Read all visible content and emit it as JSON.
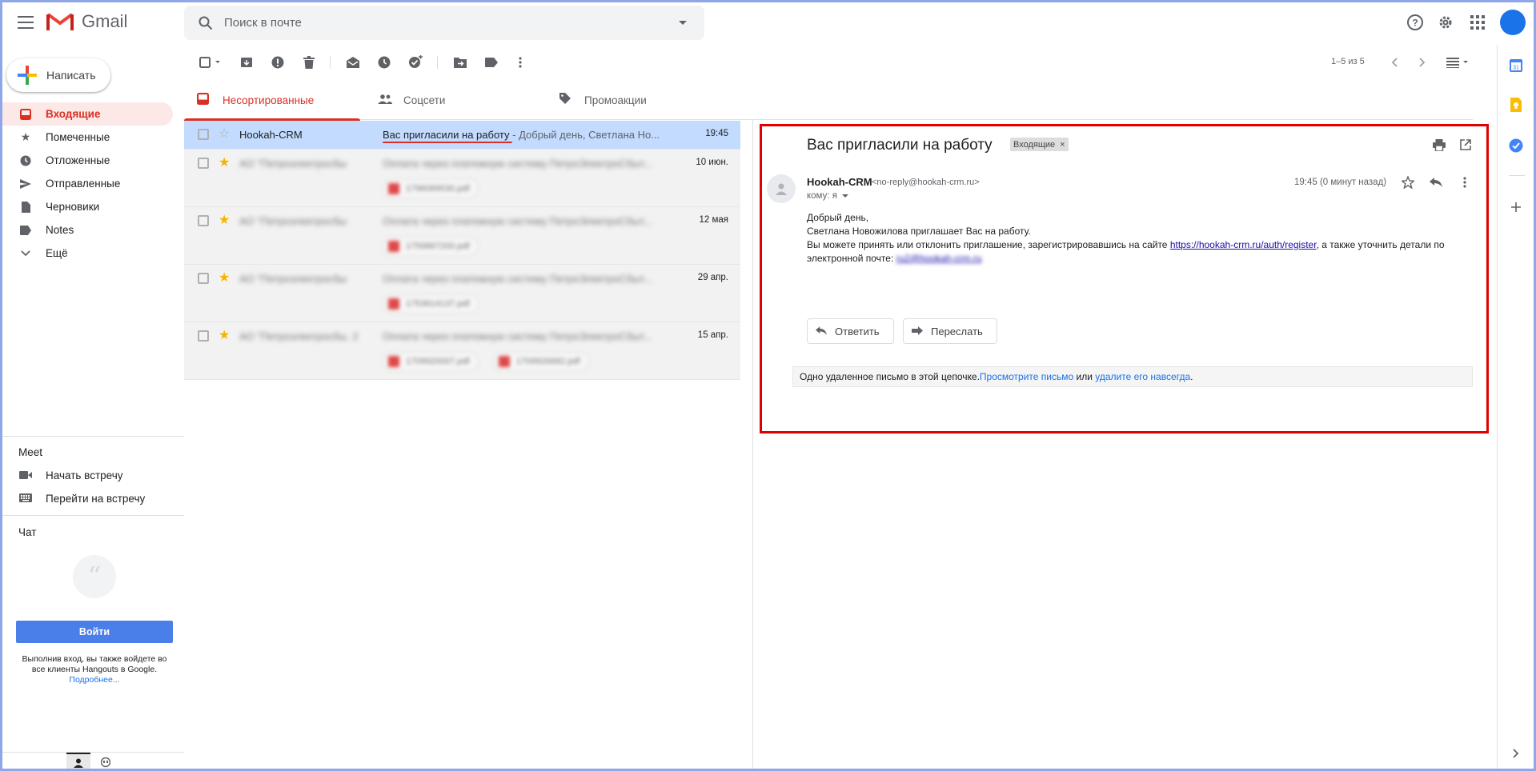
{
  "app": {
    "name": "Gmail"
  },
  "search": {
    "placeholder": "Поиск в почте"
  },
  "compose": {
    "label": "Написать"
  },
  "nav": [
    {
      "label": "Входящие",
      "icon": "inbox-icon",
      "active": true
    },
    {
      "label": "Помеченные",
      "icon": "star-icon"
    },
    {
      "label": "Отложенные",
      "icon": "clock-icon"
    },
    {
      "label": "Отправленные",
      "icon": "send-icon"
    },
    {
      "label": "Черновики",
      "icon": "draft-icon"
    },
    {
      "label": "Notes",
      "icon": "label-icon"
    },
    {
      "label": "Ещё",
      "icon": "chevron-down-icon"
    }
  ],
  "meet": {
    "title": "Meet",
    "items": [
      {
        "label": "Начать встречу",
        "icon": "video-icon"
      },
      {
        "label": "Перейти на встречу",
        "icon": "keyboard-icon"
      }
    ]
  },
  "chat": {
    "title": "Чат",
    "signin_label": "Войти",
    "note": "Выполнив вход, вы также войдете во все клиенты Hangouts в Google.",
    "more_link": "Подробнее..."
  },
  "toolbar": {
    "pagination": "1–5 из 5"
  },
  "tabs": [
    {
      "label": "Несортированные",
      "icon": "inbox-icon",
      "active": true
    },
    {
      "label": "Соцсети",
      "icon": "people-icon"
    },
    {
      "label": "Промоакции",
      "icon": "tag-icon"
    }
  ],
  "messages": [
    {
      "sender": "Hookah-CRM",
      "subject": "Вас пригласили на работу",
      "snippet": " - Добрый день, Светлана Но...",
      "date": "19:45",
      "starred": false,
      "blurred": false,
      "attachments": []
    },
    {
      "sender": "АО \"Петроэлектросбы",
      "subject": "Оплата через платежную систему ПетроЭлектроСбыт...",
      "snippet": "",
      "date": "10 июн.",
      "starred": true,
      "blurred": true,
      "attachments": [
        "1796069530.pdf"
      ]
    },
    {
      "sender": "АО \"Петроэлектросбы",
      "subject": "Оплата через платежную систему ПетроЭлектроСбыт...",
      "snippet": "",
      "date": "12 мая",
      "starred": true,
      "blurred": true,
      "attachments": [
        "1759867200.pdf"
      ]
    },
    {
      "sender": "АО \"Петроэлектросбы",
      "subject": "Оплата через платежную систему ПетроЭлектроСбыт...",
      "snippet": "",
      "date": "29 апр.",
      "starred": true,
      "blurred": true,
      "attachments": [
        "1753614137.pdf"
      ]
    },
    {
      "sender": "АО \"Петроэлектросбы. 2",
      "subject": "Оплата через платежную систему ПетроЭлектроСбыт...",
      "snippet": "",
      "date": "15 апр.",
      "starred": true,
      "blurred": true,
      "attachments": [
        "1709920007.pdf",
        "1709926682.pdf"
      ]
    }
  ],
  "reading": {
    "title": "Вас пригласили на работу",
    "label_chip": "Входящие",
    "chip_close": "×",
    "sender_name": "Hookah-CRM",
    "sender_email": "<no-reply@hookah-crm.ru>",
    "to_line": "кому: я",
    "time": "19:45 (0 минут назад)",
    "body_line1": "Добрый день,",
    "body_line2": "Светлана Новожилова приглашает Вас на работу.",
    "body_line3_before": "Вы можете принять или отклонить приглашение, зарегистрировавшись на сайте ",
    "body_link": "https://hookah-crm.ru/auth/register",
    "body_line3_after": ", а также уточнить детали по",
    "body_line4": "электронной почте: ",
    "body_email": "ru2@hookah-crm.ru",
    "reply_label": "Ответить",
    "forward_label": "Переслать",
    "deleted_text": "Одно удаленное письмо в этой цепочке. ",
    "deleted_view_link": "Просмотрите письмо",
    "deleted_or": " или ",
    "deleted_delete_link": "удалите его навсегда",
    "deleted_end": "."
  },
  "colors": {
    "accent": "#d93025",
    "highlight": "#e00000",
    "selected_row": "#c2dbff",
    "signin": "#4a7ee8"
  }
}
